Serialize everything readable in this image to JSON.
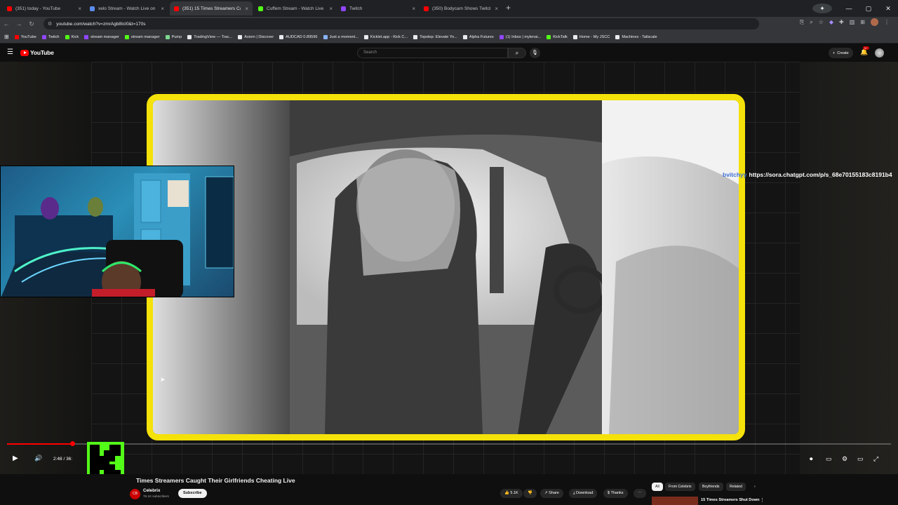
{
  "browser": {
    "tabs": [
      {
        "title": "(351) today - YouTube",
        "color": "#ff0000",
        "active": false
      },
      {
        "title": "xelo Stream - Watch Live on Ki",
        "color": "#5b8def",
        "active": false
      },
      {
        "title": "(351) 15 Times Streamers Caug",
        "color": "#ff0000",
        "active": true
      },
      {
        "title": "Cuffem Stream - Watch Live on",
        "color": "#53fc18",
        "active": false
      },
      {
        "title": "Twitch",
        "color": "#9146ff",
        "active": false
      },
      {
        "title": "(350) Bodycam Shows Twitch S",
        "color": "#ff0000",
        "active": false
      }
    ],
    "url": "youtube.com/watch?v=zmrAgb8IcI0&t=170s",
    "bookmarks": [
      {
        "label": "YouTube",
        "color": "#ff0000"
      },
      {
        "label": "Twitch",
        "color": "#9146ff"
      },
      {
        "label": "Kick",
        "color": "#53fc18"
      },
      {
        "label": "stream manager",
        "color": "#9146ff"
      },
      {
        "label": "stream manager",
        "color": "#53fc18"
      },
      {
        "label": "Pump",
        "color": "#7bd88f"
      },
      {
        "label": "TradingView — Trac...",
        "color": "#e8eaed"
      },
      {
        "label": "Axiom | Discover",
        "color": "#e8eaed"
      },
      {
        "label": "AUDCAD 0.89596",
        "color": "#e8eaed"
      },
      {
        "label": "Just a moment...",
        "color": "#8ab4f8"
      },
      {
        "label": "Kicklet.app - Kick C...",
        "color": "#e8eaed"
      },
      {
        "label": "Topstep: Elevate Yo...",
        "color": "#e8eaed"
      },
      {
        "label": "Alpha Futures",
        "color": "#e8eaed"
      },
      {
        "label": "(1) Inbox | mylenai...",
        "color": "#9146ff"
      },
      {
        "label": "KickTalk",
        "color": "#53fc18"
      },
      {
        "label": "Home - My JSCC",
        "color": "#e8eaed"
      },
      {
        "label": "Machines - Tailscale",
        "color": "#e8eaed"
      }
    ]
  },
  "youtube": {
    "logo_text": "YouTube",
    "search_placeholder": "Search",
    "create_label": "Create",
    "notification_count": "9+"
  },
  "player": {
    "chat_user": "bvitchyy",
    "chat_message": "https://sora.chatgpt.com/p/s_68e70155183c8191b4",
    "time_display": "2:48 / 36:",
    "progress_fraction": 0.074
  },
  "video": {
    "title": "Times Streamers Caught Their Girlfriends Cheating Live",
    "channel_name": "Celebrix",
    "subscribers": "76.1K subscribers",
    "subscribe_label": "Subscribe",
    "like_count": "5.1K",
    "share_label": "Share",
    "download_label": "Download",
    "thanks_label": "Thanks",
    "chips": [
      {
        "label": "All",
        "active": true
      },
      {
        "label": "From Celebrix",
        "active": false
      },
      {
        "label": "Boyfriends",
        "active": false
      },
      {
        "label": "Related",
        "active": false
      }
    ],
    "recommended_title": "15 Times Streamers Shut Down"
  }
}
